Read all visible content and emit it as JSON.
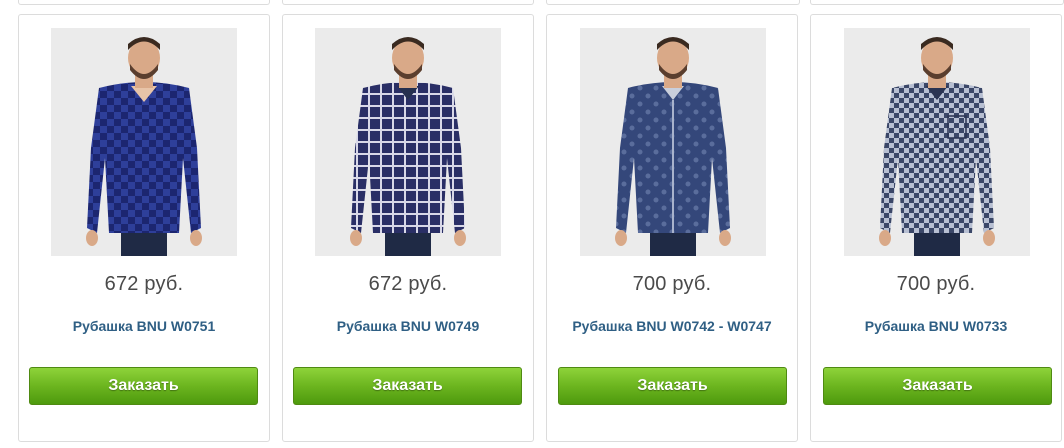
{
  "colors": {
    "price_text": "#4a4a4a",
    "name_link": "#2f5f84",
    "button_green": "#6cb51f",
    "card_border": "#dcdcdc"
  },
  "products": [
    {
      "image_alt": "man-wearing-blue-checked-shirt",
      "shirt_color": "#2e3f9a",
      "pattern_color": "#1c2670",
      "price": "672 руб.",
      "name": "Рубашка BNU W0751",
      "button_label": "Заказать"
    },
    {
      "image_alt": "man-wearing-navy-plaid-shirt",
      "shirt_color": "#2a2f66",
      "pattern_color": "#d8d8e8",
      "price": "672 руб.",
      "name": "Рубашка BNU W0749",
      "button_label": "Заказать"
    },
    {
      "image_alt": "man-wearing-navy-paisley-shirt",
      "shirt_color": "#34477a",
      "pattern_color": "#5a6d9c",
      "price": "700 руб.",
      "name": "Рубашка BNU W0742 - W0747",
      "button_label": "Заказать"
    },
    {
      "image_alt": "man-wearing-grey-blue-checked-shirt",
      "shirt_color": "#3b4768",
      "pattern_color": "#b7bfd2",
      "price": "700 руб.",
      "name": "Рубашка BNU W0733",
      "button_label": "Заказать"
    }
  ]
}
